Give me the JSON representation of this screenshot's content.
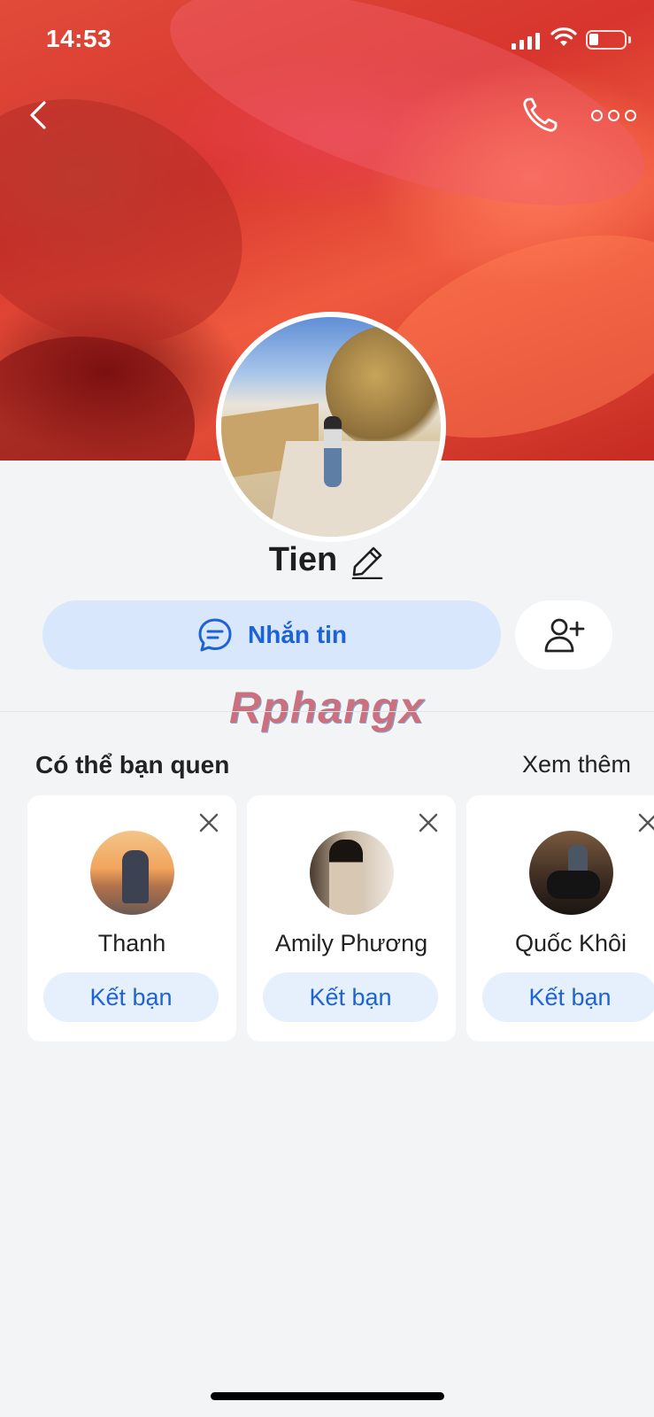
{
  "status_bar": {
    "time": "14:53"
  },
  "header": {
    "back_icon": "chevron-left-icon",
    "call_icon": "phone-icon",
    "more_icon": "more-dots-icon"
  },
  "profile": {
    "name": "Tien",
    "edit_icon": "pencil-icon"
  },
  "actions": {
    "message_label": "Nhắn tin",
    "message_icon": "chat-bubble-icon",
    "add_friend_icon": "add-user-icon"
  },
  "watermark": "Rphangx",
  "suggestions": {
    "title": "Có thể bạn quen",
    "see_more": "Xem thêm",
    "items": [
      {
        "name": "Thanh",
        "button": "Kết bạn"
      },
      {
        "name": "Amily Phương",
        "button": "Kết bạn"
      },
      {
        "name": "Quốc Khôi",
        "button": "Kết bạn"
      }
    ]
  },
  "colors": {
    "accent": "#1d63d6",
    "accent_soft": "#d8e7fc",
    "background": "#f3f4f6"
  }
}
